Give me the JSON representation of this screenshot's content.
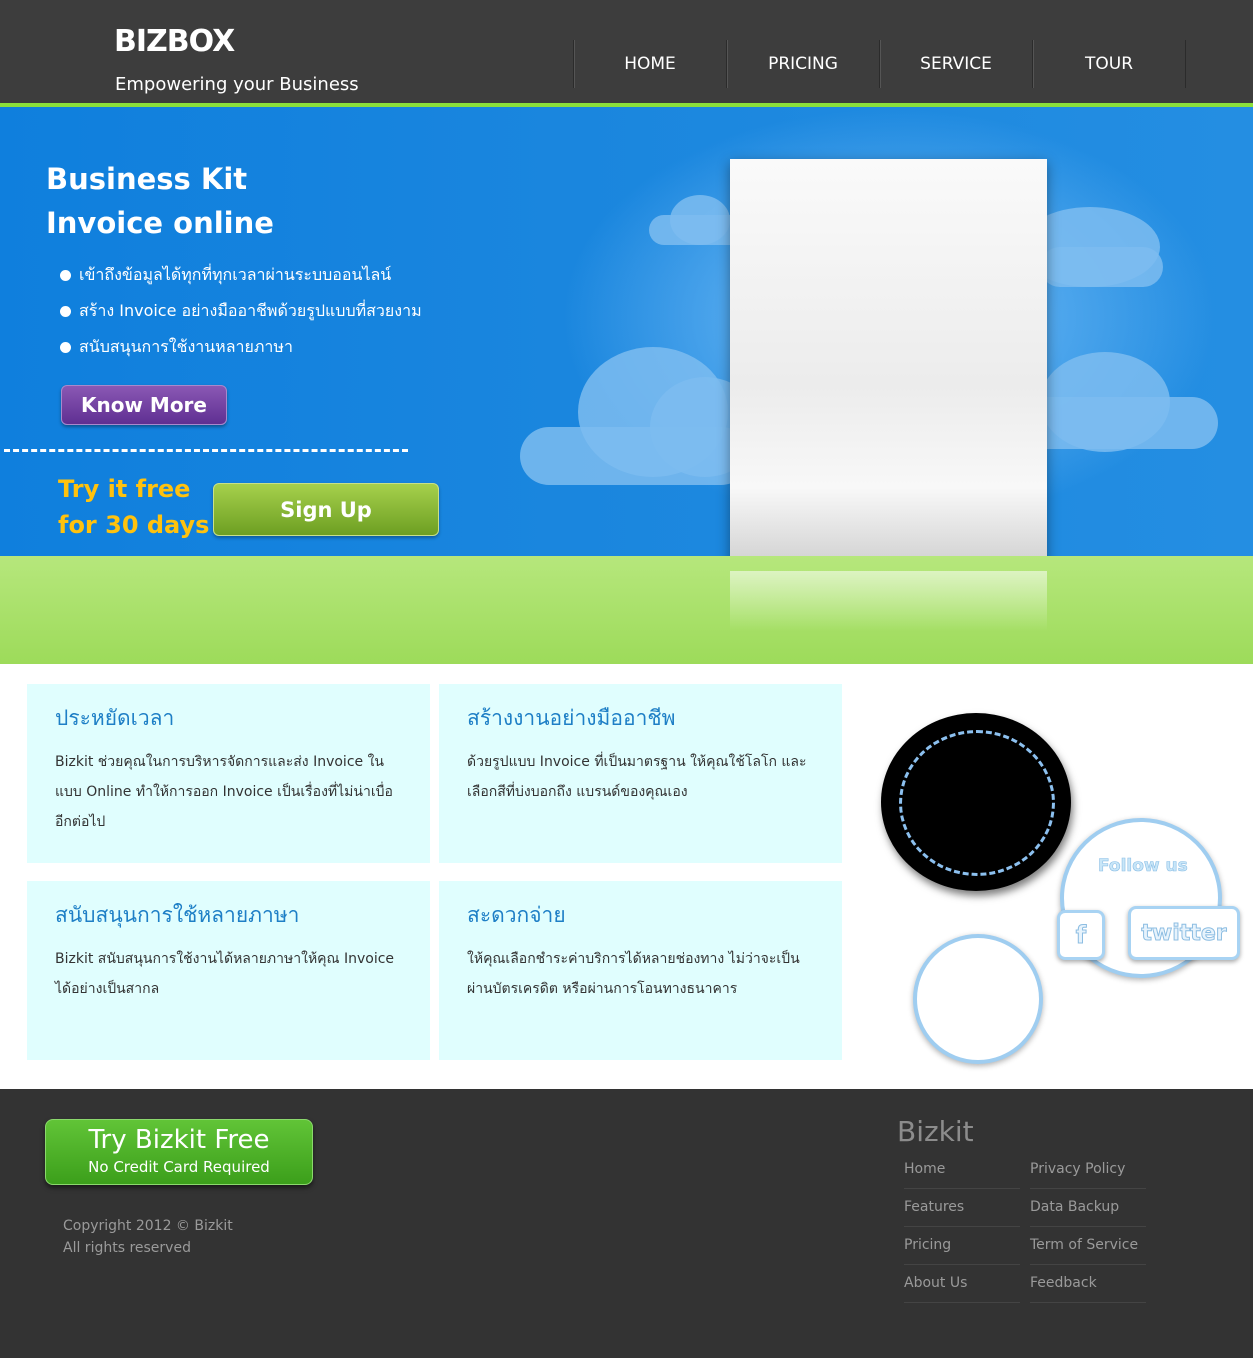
{
  "header": {
    "logo": "BIZBOX",
    "tagline": "Empowering your Business",
    "nav": [
      "HOME",
      "PRICING",
      "SERVICE",
      "TOUR"
    ]
  },
  "hero": {
    "title_line1": "Business Kit",
    "title_line2": "Invoice online",
    "bullets": [
      "เข้าถึงข้อมูลได้ทุกที่ทุกเวลาผ่านระบบออนไลน์",
      "สร้าง Invoice อย่างมืออาชีพด้วยรูปแบบที่สวยงาม",
      "สนับสนุนการใช้งานหลายภาษา"
    ],
    "know_more": "Know More",
    "try_line1": "Try it free",
    "try_line2": "for 30 days",
    "sign_up": "Sign Up"
  },
  "features": [
    {
      "title": "ประหยัดเวลา",
      "text": "Bizkit ช่วยคุณในการบริหารจัดการและส่ง Invoice ในแบบ Online ทำให้การออก Invoice เป็นเรื่องที่ไม่น่าเบื่ออีกต่อไป"
    },
    {
      "title": "สร้างงานอย่างมืออาชีพ",
      "text": "ด้วยรูปแบบ Invoice ที่เป็นมาตรฐาน ให้คุณใช้โลโก และเลือกสีที่บ่งบอกถึง แบรนด์ของคุณเอง"
    },
    {
      "title": "สนับสนุนการใช้หลายภาษา",
      "text": "Bizkit สนับสนุนการใช้งานได้หลายภาษาให้คุณ Invoice ได้อย่างเป็นสากล"
    },
    {
      "title": "สะดวกจ่าย",
      "text": "ให้คุณเลือกชำระค่าบริการได้หลายช่องทาง ไม่ว่าจะเป็นผ่านบัตรเครดิต หรือผ่านการโอนทางธนาคาร"
    }
  ],
  "social": {
    "follow": "Follow us",
    "facebook": "f",
    "twitter": "twitter"
  },
  "footer": {
    "try_main": "Try Bizkit Free",
    "try_sub": "No Credit Card Required",
    "copyright_line1": "Copyright 2012 © Bizkit",
    "copyright_line2": "All rights reserved",
    "brand": "Bizkit",
    "links": [
      "Home",
      "Privacy Policy",
      "Features",
      "Data Backup",
      "Pricing",
      "Term of Service",
      "About Us",
      "Feedback"
    ]
  },
  "colors": {
    "header_bg": "#3d3d3d",
    "accent_green": "#8be03a",
    "hero_blue": "#1a86de",
    "feature_bg": "#e0fefe",
    "feature_title": "#1e7fc6",
    "try_yellow": "#ffc20e",
    "footer_bg": "#333333"
  }
}
